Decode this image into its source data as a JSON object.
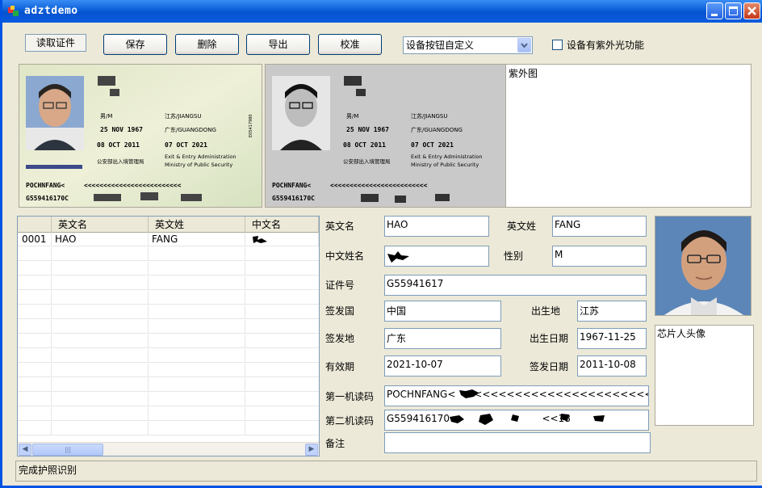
{
  "window": {
    "title": "adztdemo"
  },
  "toolbar": {
    "read_label": "读取证件",
    "save_label": "保存",
    "delete_label": "删除",
    "export_label": "导出",
    "calibrate_label": "校准",
    "custom_select_value": "设备按钮自定义",
    "uv_checkbox_label": "设备有紫外光功能",
    "uv_checkbox_checked": false
  },
  "passport_image": {
    "mrz_line1": "POCHNFANG<",
    "mrz_line2": "G559416170C",
    "sex": "男/M",
    "place_of_birth": "江苏/JIANGSU",
    "dob": "25 NOV 1967",
    "place_of_issue": "广东/GUANGDONG",
    "issue_date": "08 OCT 2011",
    "expiry_date": "07 OCT 2021",
    "authority_cn": "公安部出入境管理局",
    "authority_en1": "Exit & Entry Administration",
    "authority_en2": "Ministry of Public Security"
  },
  "uv_panel": {
    "label": "紫外图"
  },
  "grid": {
    "columns": [
      "",
      "英文名",
      "英文姓",
      "中文名"
    ],
    "rows": [
      {
        "id": "0001",
        "en_name": "HAO",
        "en_surname": "FANG",
        "cn_name": ""
      }
    ]
  },
  "form": {
    "en_name": {
      "label": "英文名",
      "value": "HAO"
    },
    "en_surname": {
      "label": "英文姓",
      "value": "FANG"
    },
    "cn_name": {
      "label": "中文姓名",
      "value": ""
    },
    "gender": {
      "label": "性别",
      "value": "M"
    },
    "doc_no": {
      "label": "证件号",
      "value": "G55941617"
    },
    "issue_country": {
      "label": "签发国",
      "value": "中国"
    },
    "birthplace": {
      "label": "出生地",
      "value": "江苏"
    },
    "issue_place": {
      "label": "签发地",
      "value": "广东"
    },
    "birth_date": {
      "label": "出生日期",
      "value": "1967-11-25"
    },
    "valid_until": {
      "label": "有效期",
      "value": "2021-10-07"
    },
    "issue_date": {
      "label": "签发日期",
      "value": "2011-10-08"
    },
    "mrz1": {
      "label": "第一机读码",
      "value": "POCHNFANG<      <<<<<<<<<<<<<<<<<<<<<<<<<"
    },
    "mrz2": {
      "label": "第二机读码",
      "value": "G559416170                              <<18"
    },
    "remarks": {
      "label": "备注",
      "value": ""
    }
  },
  "chip_panel": {
    "label": "芯片人头像"
  },
  "status": {
    "text": "完成护照识别"
  }
}
